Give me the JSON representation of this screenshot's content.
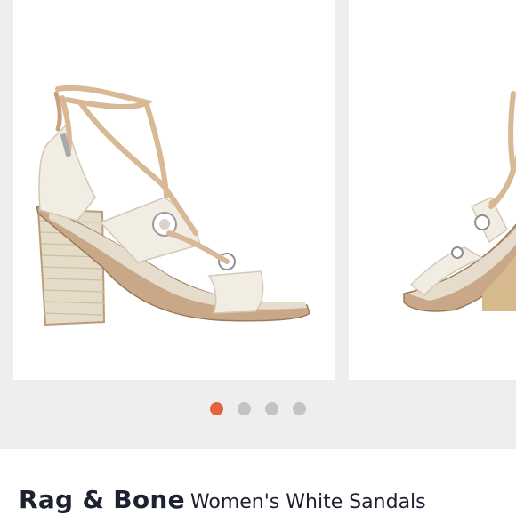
{
  "product": {
    "brand": "Rag & Bone",
    "description": "Women's White Sandals"
  },
  "gallery": {
    "slides": [
      {
        "icon": "sandal-photo-icon"
      },
      {
        "icon": "sandal-photo-icon"
      }
    ],
    "dots_total": 4,
    "active_index": 0
  },
  "colors": {
    "accent": "#e4633d",
    "dot_inactive": "#c3c3c7",
    "background": "#eeeeef",
    "text": "#1e2230"
  }
}
